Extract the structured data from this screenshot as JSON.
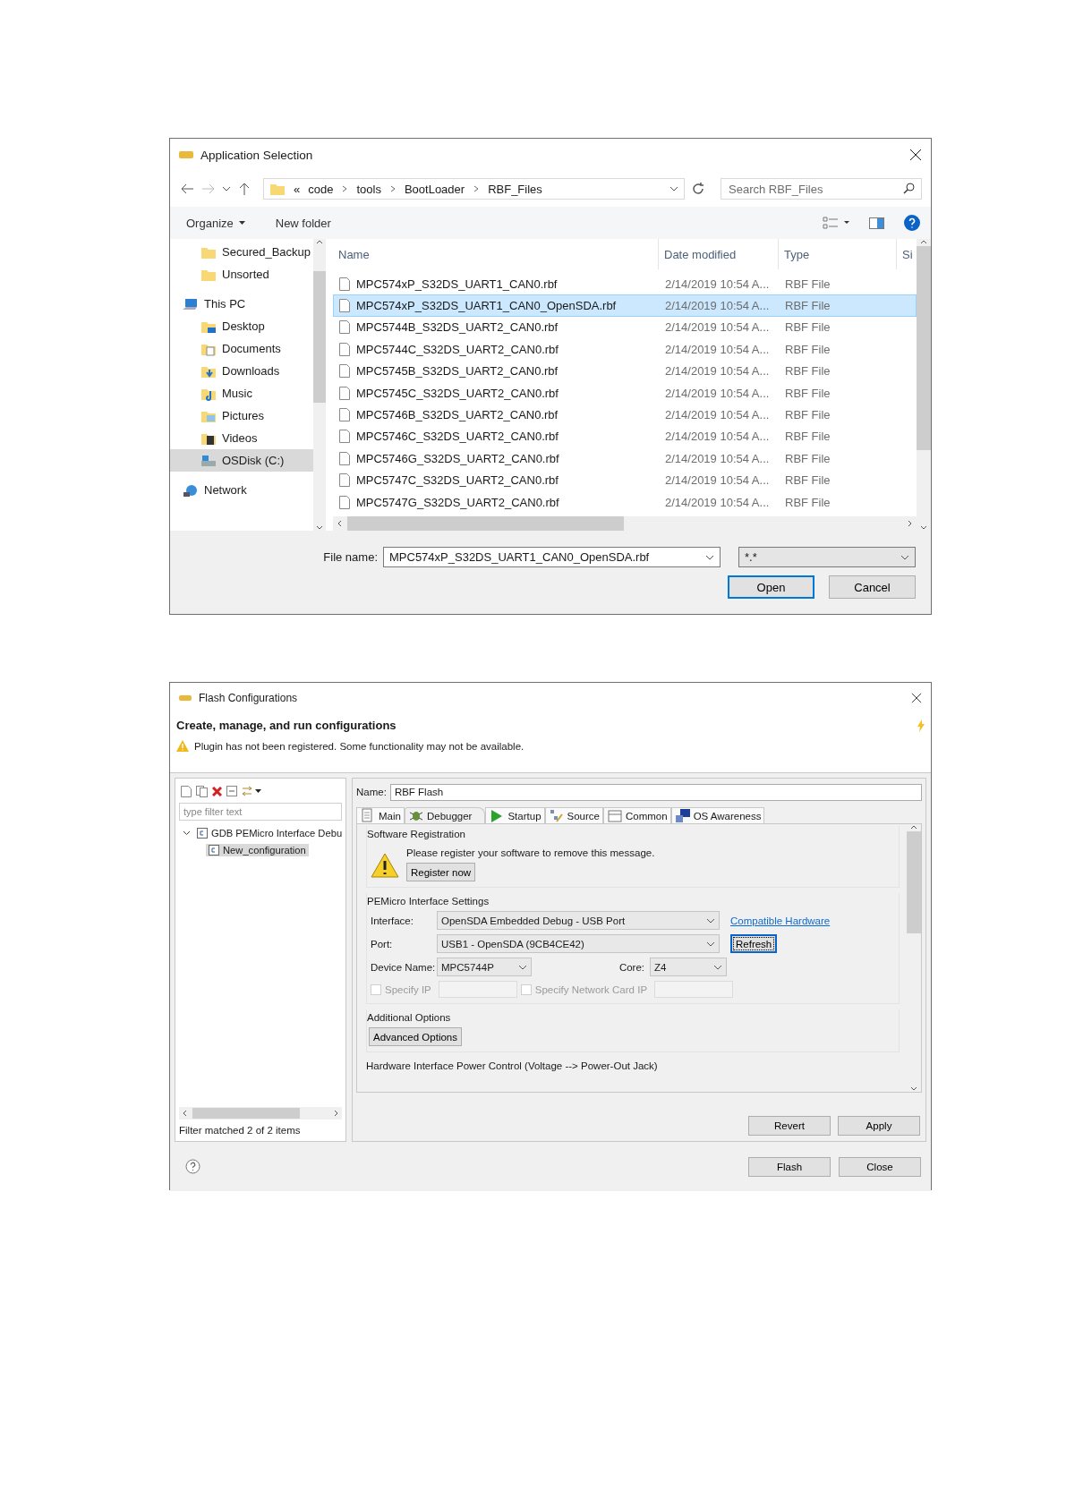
{
  "file_dialog": {
    "title": "Application Selection",
    "breadcrumb": {
      "overflow": "«",
      "parts": [
        "code",
        "tools",
        "BootLoader",
        "RBF_Files"
      ]
    },
    "search": {
      "placeholder": "Search RBF_Files"
    },
    "commands": [
      {
        "label": "Organize",
        "dropdown": true
      },
      {
        "label": "New folder",
        "dropdown": false
      }
    ],
    "nav": [
      {
        "label": "Secured_Backup",
        "kind": "folder",
        "selected": false
      },
      {
        "label": "Unsorted",
        "kind": "folder",
        "selected": false
      },
      {
        "label": "This PC",
        "kind": "pc",
        "selected": false,
        "children": [
          {
            "label": "Desktop",
            "kind": "desktop",
            "selected": false
          },
          {
            "label": "Documents",
            "kind": "documents",
            "selected": false
          },
          {
            "label": "Downloads",
            "kind": "downloads",
            "selected": false
          },
          {
            "label": "Music",
            "kind": "music",
            "selected": false
          },
          {
            "label": "Pictures",
            "kind": "pictures",
            "selected": false
          },
          {
            "label": "Videos",
            "kind": "videos",
            "selected": false
          },
          {
            "label": "OSDisk (C:)",
            "kind": "disk",
            "selected": true
          }
        ]
      },
      {
        "label": "Network",
        "kind": "network",
        "selected": false
      }
    ],
    "columns": [
      "Name",
      "Date modified",
      "Type",
      "Si"
    ],
    "files": [
      {
        "name": "MPC574xP_S32DS_UART1_CAN0.rbf",
        "date": "2/14/2019 10:54 A...",
        "type": "RBF File",
        "selected": false
      },
      {
        "name": "MPC574xP_S32DS_UART1_CAN0_OpenSDA.rbf",
        "date": "2/14/2019 10:54 A...",
        "type": "RBF File",
        "selected": true
      },
      {
        "name": "MPC5744B_S32DS_UART2_CAN0.rbf",
        "date": "2/14/2019 10:54 A...",
        "type": "RBF File",
        "selected": false
      },
      {
        "name": "MPC5744C_S32DS_UART2_CAN0.rbf",
        "date": "2/14/2019 10:54 A...",
        "type": "RBF File",
        "selected": false
      },
      {
        "name": "MPC5745B_S32DS_UART2_CAN0.rbf",
        "date": "2/14/2019 10:54 A...",
        "type": "RBF File",
        "selected": false
      },
      {
        "name": "MPC5745C_S32DS_UART2_CAN0.rbf",
        "date": "2/14/2019 10:54 A...",
        "type": "RBF File",
        "selected": false
      },
      {
        "name": "MPC5746B_S32DS_UART2_CAN0.rbf",
        "date": "2/14/2019 10:54 A...",
        "type": "RBF File",
        "selected": false
      },
      {
        "name": "MPC5746C_S32DS_UART2_CAN0.rbf",
        "date": "2/14/2019 10:54 A...",
        "type": "RBF File",
        "selected": false
      },
      {
        "name": "MPC5746G_S32DS_UART2_CAN0.rbf",
        "date": "2/14/2019 10:54 A...",
        "type": "RBF File",
        "selected": false
      },
      {
        "name": "MPC5747C_S32DS_UART2_CAN0.rbf",
        "date": "2/14/2019 10:54 A...",
        "type": "RBF File",
        "selected": false
      },
      {
        "name": "MPC5747G_S32DS_UART2_CAN0.rbf",
        "date": "2/14/2019 10:54 A...",
        "type": "RBF File",
        "selected": false
      }
    ],
    "file_name": {
      "label": "File name:",
      "value": "MPC574xP_S32DS_UART1_CAN0_OpenSDA.rbf"
    },
    "filter": {
      "value": "*.*"
    },
    "buttons": [
      {
        "label": "Open",
        "focused": true
      },
      {
        "label": "Cancel",
        "focused": false
      }
    ]
  },
  "flash_dialog": {
    "title": "Flash Configurations",
    "heading": "Create, manage, and run configurations",
    "warning": "Plugin has not been registered. Some functionality may not be available.",
    "filter": {
      "placeholder": "type filter text"
    },
    "tree": [
      {
        "label": "GDB PEMicro Interface Debu",
        "expanded": true,
        "selected": false,
        "children": [
          {
            "label": "New_configuration",
            "selected": true
          }
        ]
      }
    ],
    "filter_status": "Filter matched 2 of 2 items",
    "name": {
      "label": "Name:",
      "value": "RBF Flash"
    },
    "tabs": [
      {
        "label": "Main",
        "kind": "main",
        "selected": false
      },
      {
        "label": "Debugger",
        "kind": "debugger",
        "selected": true
      },
      {
        "label": "Startup",
        "kind": "startup",
        "selected": false
      },
      {
        "label": "Source",
        "kind": "source",
        "selected": false
      },
      {
        "label": "Common",
        "kind": "common",
        "selected": false
      },
      {
        "label": "OS Awareness",
        "kind": "os",
        "selected": false
      }
    ],
    "registration": {
      "title": "Software Registration",
      "message": "Please register your software to remove this message.",
      "button": "Register now"
    },
    "interface_settings": {
      "title": "PEMicro Interface Settings",
      "interface": {
        "label": "Interface:",
        "value": "OpenSDA Embedded Debug - USB Port"
      },
      "link": "Compatible Hardware",
      "port": {
        "label": "Port:",
        "value": "USB1 - OpenSDA (9CB4CE42)"
      },
      "refresh": {
        "label": "Refresh",
        "focused": true
      },
      "device": {
        "label": "Device Name:",
        "value": "MPC5744P"
      },
      "core": {
        "label": "Core:",
        "value": "Z4"
      },
      "checks": [
        {
          "label": "Specify IP",
          "checked": false,
          "disabled": true
        },
        {
          "label": "Specify Network Card IP",
          "checked": false,
          "disabled": true
        }
      ]
    },
    "additional": {
      "title": "Additional Options",
      "button": "Advanced Options"
    },
    "power_title": "Hardware Interface Power Control (Voltage --> Power-Out Jack)",
    "actions": [
      "Revert",
      "Apply"
    ],
    "footer_buttons": [
      "Flash",
      "Close"
    ]
  }
}
